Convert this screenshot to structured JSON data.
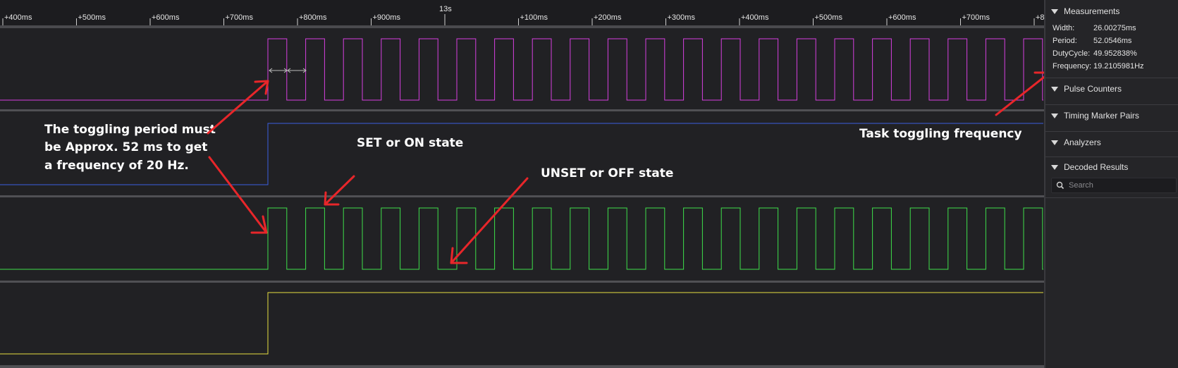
{
  "timeline": {
    "ticks": [
      "+400ms",
      "+500ms",
      "+600ms",
      "+700ms",
      "+800ms",
      "+900ms",
      "13s",
      "+100ms",
      "+200ms",
      "+300ms",
      "+400ms",
      "+500ms",
      "+600ms",
      "+700ms",
      "+8"
    ]
  },
  "annotations": {
    "period_note_line1": "The toggling period must",
    "period_note_line2": "be Approx. 52 ms to get",
    "period_note_line3": "a frequency of 20 Hz.",
    "set_state": "SET or ON state",
    "unset_state": "UNSET or OFF state",
    "task_freq": "Task toggling frequency"
  },
  "sidebar": {
    "measurements": {
      "title": "Measurements",
      "rows": [
        {
          "label": "Width:",
          "value": "26.00275ms"
        },
        {
          "label": "Period:",
          "value": "52.0546ms"
        },
        {
          "label": "DutyCycle:",
          "value": "49.952838%"
        },
        {
          "label": "Frequency:",
          "value": "19.2105981Hz"
        }
      ]
    },
    "pulse_counters": "Pulse Counters",
    "timing_marker_pairs": "Timing Marker Pairs",
    "analyzers": "Analyzers",
    "decoded_results": "Decoded Results",
    "search_placeholder": "Search"
  },
  "colors": {
    "channel0": "#d63fe0",
    "channel1": "#3c5fe0",
    "channel2": "#3ee04a",
    "channel3": "#e8e040",
    "arrow": "#e8262a"
  }
}
